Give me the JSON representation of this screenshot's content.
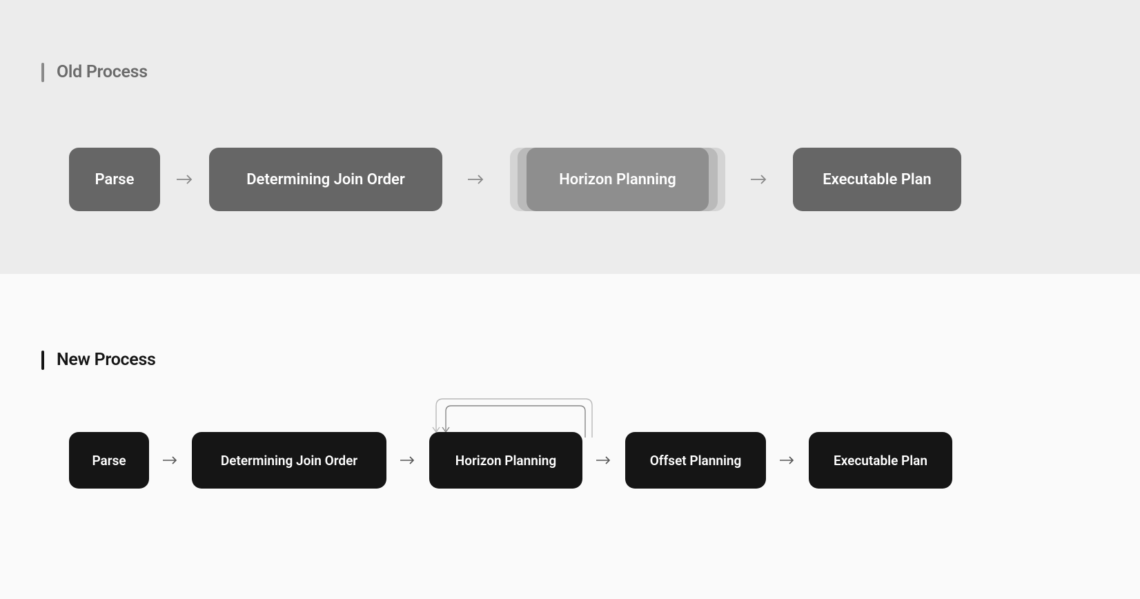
{
  "old_process": {
    "title": "Old Process",
    "steps": [
      {
        "label": "Parse"
      },
      {
        "label": "Determining Join Order"
      },
      {
        "label": "Horizon Planning",
        "stacked": true
      },
      {
        "label": "Executable Plan"
      }
    ]
  },
  "new_process": {
    "title": "New Process",
    "steps": [
      {
        "label": "Parse"
      },
      {
        "label": "Determining Join Order"
      },
      {
        "label": "Horizon Planning",
        "loop": true
      },
      {
        "label": "Offset Planning"
      },
      {
        "label": "Executable Plan"
      }
    ]
  }
}
